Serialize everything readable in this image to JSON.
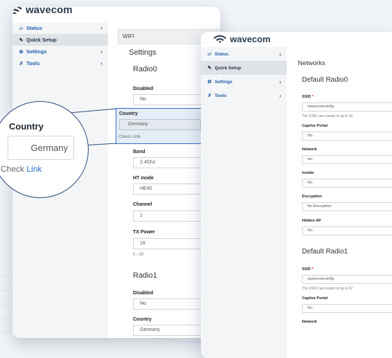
{
  "brand": "wavecom",
  "colors": {
    "accent": "#2a6bc8",
    "nav_text": "#1f5fa8",
    "brand_text": "#2b3b4d"
  },
  "nav": [
    {
      "icon": "chart-icon",
      "label": "Status",
      "chevron": "‹"
    },
    {
      "icon": "wand-icon",
      "label": "Quick Setup",
      "chevron": ""
    },
    {
      "icon": "gear-icon",
      "label": "Settings",
      "chevron": "‹"
    },
    {
      "icon": "wrench-icon",
      "label": "Tools",
      "chevron": "‹"
    }
  ],
  "win1": {
    "breadcrumb": "WIFI",
    "section": "Settings",
    "radio0": "Radio0",
    "radio1": "Radio1",
    "fields": {
      "disabled_label": "Disabled",
      "disabled_value": "No",
      "country_label": "Country",
      "country_value": "Germany",
      "check_link": "Check Link",
      "band_label": "Band",
      "band_value": "2.4Ghz",
      "htmode_label": "HT mode",
      "htmode_value": "HE40",
      "channel_label": "Channel",
      "channel_value": "1",
      "txpower_label": "TX Power",
      "txpower_value": "18",
      "txpower_hint": "0 - 20",
      "r1_disabled_label": "Disabled",
      "r1_disabled_value": "No",
      "r1_country_label": "Country",
      "r1_country_value": "Germany"
    }
  },
  "zoom": {
    "label": "Country",
    "value": "Germany",
    "check": "Check",
    "link": "Link"
  },
  "win2": {
    "section": "Networks",
    "radio0": "Default Radio0",
    "radio1": "Default Radio1",
    "fields": {
      "ssid_label": "SSID",
      "required_mark": "*",
      "ssid_value": "wavecomconfig",
      "ssid_hint": "The SSID can consist of up to 32",
      "portal_label": "Captive Portal",
      "portal_value": "No",
      "network_label": "Network",
      "network_value": "lan",
      "isolate_label": "Isolate",
      "isolate_value": "No",
      "enc_label": "Encryption",
      "enc_value": "No Encryption",
      "hidden_label": "Hidden AP",
      "hidden_value": "No",
      "r1_ssid_label": "SSID",
      "r1_ssid_value": "wavecomconfig",
      "r1_ssid_hint": "The SSID can consist of up to 32",
      "r1_portal_label": "Captive Portal",
      "r1_portal_value": "No",
      "r1_network_label": "Network"
    }
  }
}
